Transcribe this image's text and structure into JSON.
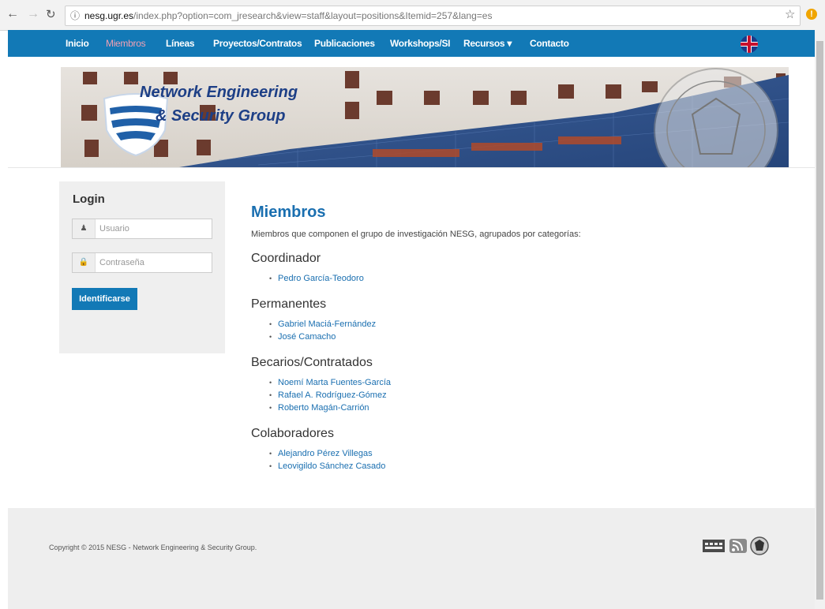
{
  "browser": {
    "back_icon": "arrow-left-icon",
    "forward_icon": "arrow-right-icon",
    "reload_icon": "reload-icon",
    "url_host": "nesg.ugr.es",
    "url_path": "/index.php?option=com_jresearch&view=staff&layout=positions&Itemid=257&lang=es"
  },
  "navbar": {
    "items": [
      "Inicio",
      "Miembros",
      "Líneas",
      "Proyectos/Contratos",
      "Publicaciones",
      "Workshops/SI",
      "Recursos ▾",
      "Contacto"
    ],
    "active_index": 1,
    "color": "#1279b6"
  },
  "banner": {
    "line1": "Network Engineering",
    "line2": "& Security Group"
  },
  "login": {
    "title": "Login",
    "username_placeholder": "Usuario",
    "password_placeholder": "Contraseña",
    "submit_label": "Identificarse"
  },
  "main": {
    "title": "Miembros",
    "intro": "Miembros que componen el grupo de investigación NESG, agrupados por categorías:",
    "groups": [
      {
        "name": "Coordinador",
        "members": [
          "Pedro García-Teodoro"
        ]
      },
      {
        "name": "Permanentes",
        "members": [
          "Gabriel Maciá-Fernández",
          "José Camacho"
        ]
      },
      {
        "name": "Becarios/Contratados",
        "members": [
          "Noemí Marta Fuentes-García",
          "Rafael A. Rodríguez-Gómez",
          "Roberto Magán-Carrión"
        ]
      },
      {
        "name": "Colaboradores",
        "members": [
          "Alejandro Pérez Villegas",
          "Leovigildo Sánchez Casado"
        ]
      }
    ]
  },
  "footer": {
    "copyright": "Copyright © 2015 NESG - Network Engineering & Security Group."
  }
}
